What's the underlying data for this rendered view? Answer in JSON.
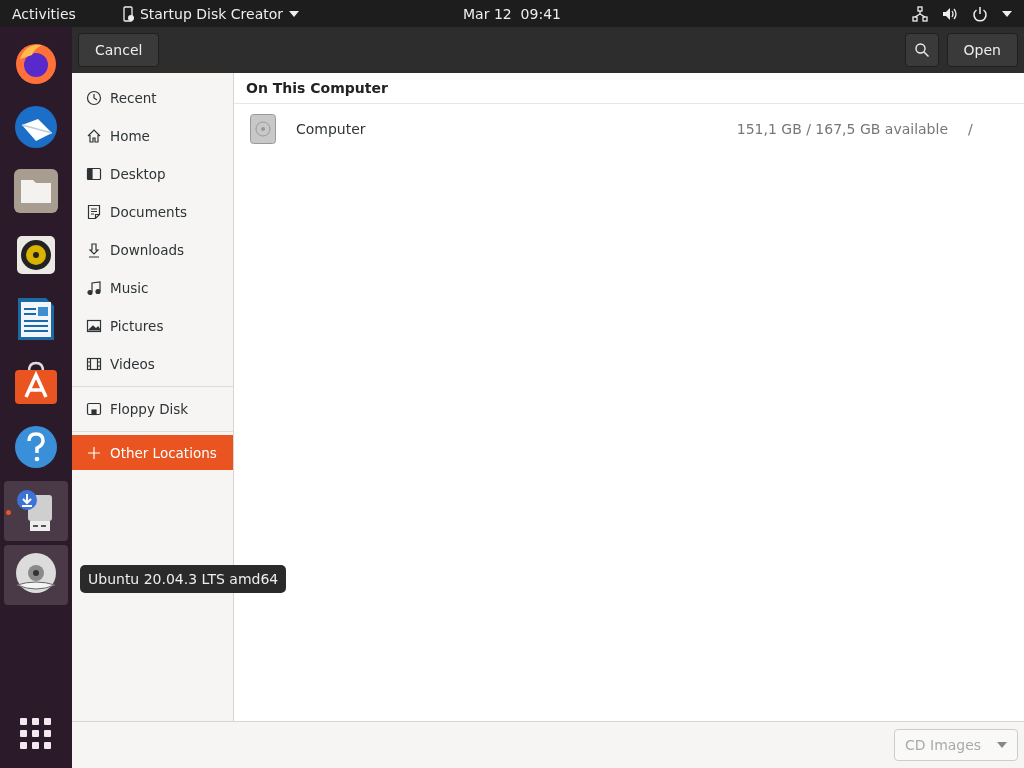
{
  "top_bar": {
    "activities": "Activities",
    "app_menu": "Startup Disk Creator",
    "clock": "Mar 12  09:41"
  },
  "dock": {
    "items": [
      {
        "kind": "firefox",
        "running": false,
        "highlighted": false
      },
      {
        "kind": "thunderbird",
        "running": false,
        "highlighted": false
      },
      {
        "kind": "files",
        "running": false,
        "highlighted": false
      },
      {
        "kind": "rhythmbox",
        "running": false,
        "highlighted": false
      },
      {
        "kind": "writer",
        "running": false,
        "highlighted": false
      },
      {
        "kind": "software",
        "running": false,
        "highlighted": false
      },
      {
        "kind": "help",
        "running": false,
        "highlighted": false
      },
      {
        "kind": "usb-creator",
        "running": true,
        "highlighted": true
      },
      {
        "kind": "dvd",
        "running": false,
        "highlighted": true
      }
    ],
    "tooltip": "Ubuntu 20.04.3 LTS amd64"
  },
  "header_bar": {
    "cancel": "Cancel",
    "open": "Open"
  },
  "sidebar": {
    "sections": [
      [
        {
          "kind": "recent",
          "label": "Recent",
          "selected": false
        },
        {
          "kind": "home",
          "label": "Home",
          "selected": false
        },
        {
          "kind": "desktop",
          "label": "Desktop",
          "selected": false
        },
        {
          "kind": "documents",
          "label": "Documents",
          "selected": false
        },
        {
          "kind": "downloads",
          "label": "Downloads",
          "selected": false
        },
        {
          "kind": "music",
          "label": "Music",
          "selected": false
        },
        {
          "kind": "pictures",
          "label": "Pictures",
          "selected": false
        },
        {
          "kind": "videos",
          "label": "Videos",
          "selected": false
        }
      ],
      [
        {
          "kind": "floppy",
          "label": "Floppy Disk",
          "selected": false
        }
      ],
      [
        {
          "kind": "plus",
          "label": "Other Locations",
          "selected": true
        }
      ]
    ]
  },
  "locations": {
    "heading": "On This Computer",
    "rows": [
      {
        "name": "Computer",
        "space": "151,1 GB / 167,5 GB available",
        "path": "/"
      }
    ]
  },
  "footer": {
    "filter": "CD Images"
  }
}
